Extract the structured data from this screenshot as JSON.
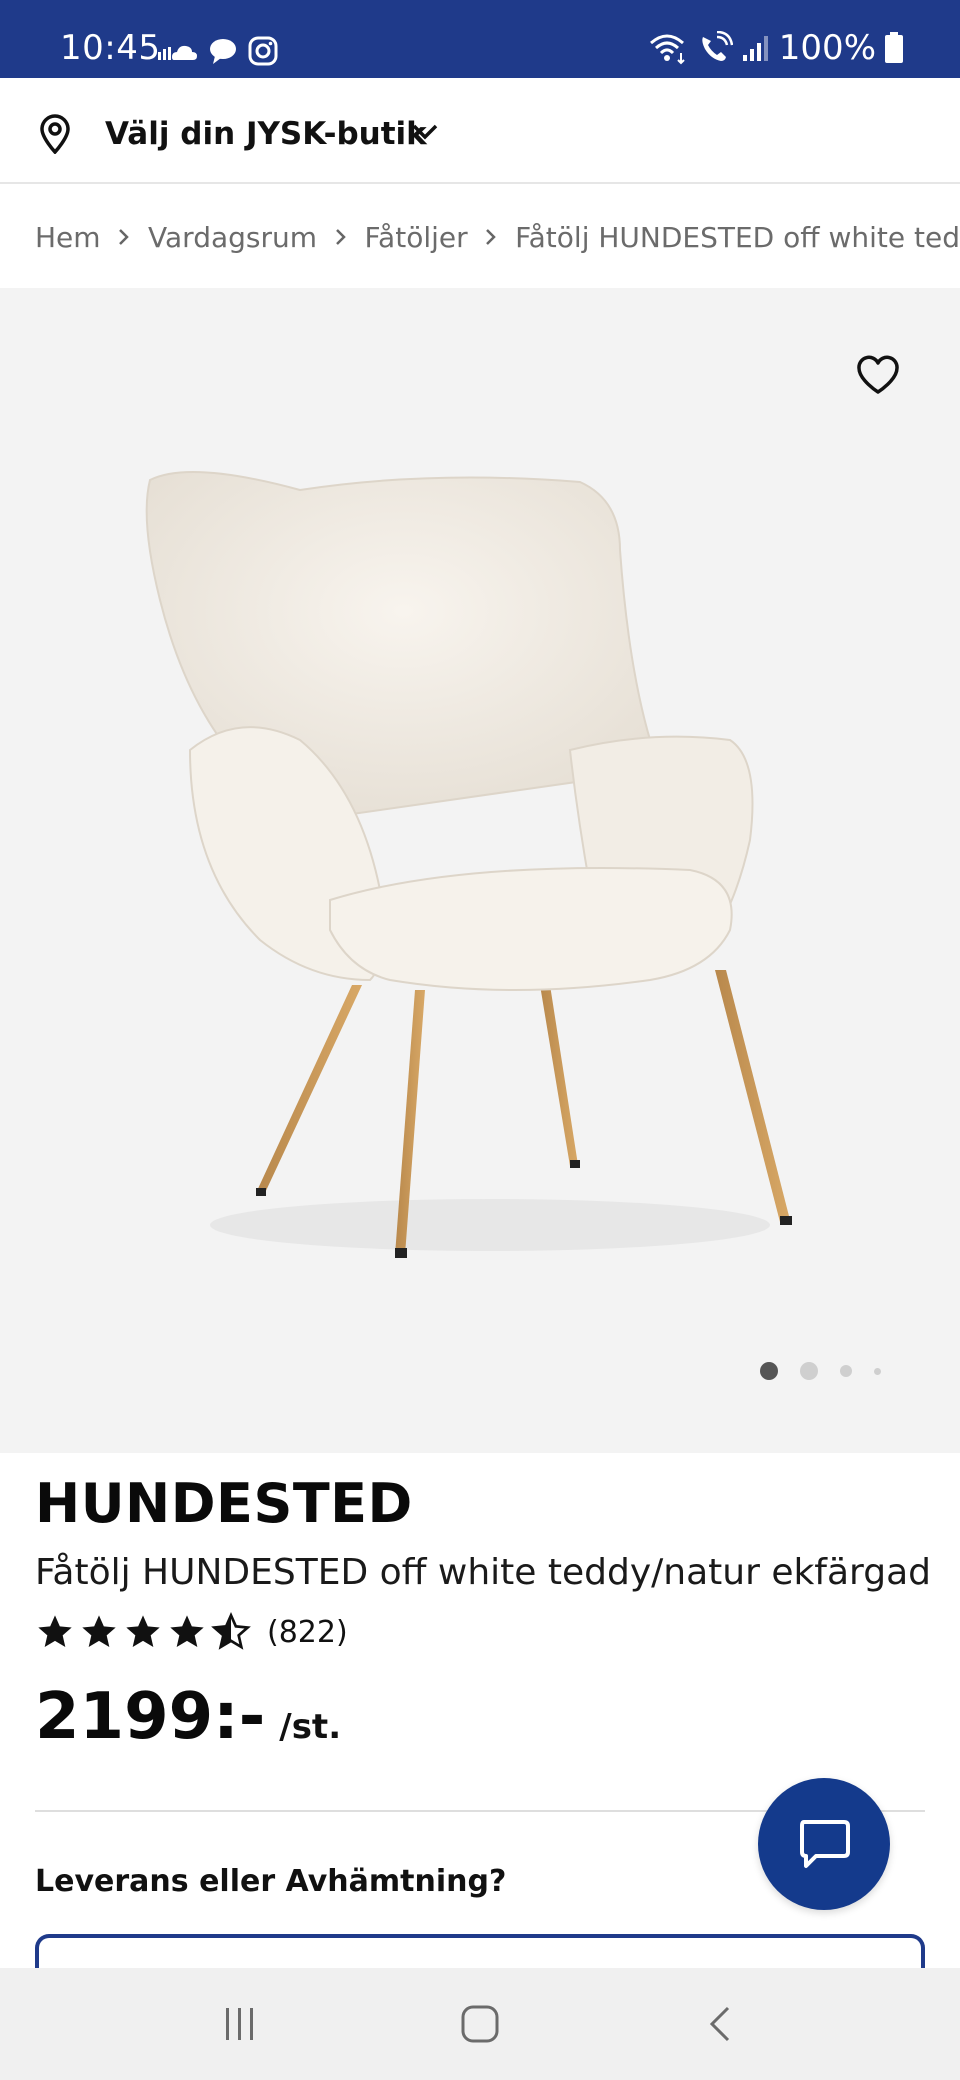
{
  "status_bar": {
    "time": "10:45",
    "battery": "100%",
    "left_icons": [
      "cloud-icon",
      "chat-bubble-icon",
      "instagram-icon"
    ],
    "right_icons": [
      "wifi-icon",
      "wifi-call-icon",
      "signal-icon",
      "battery-icon"
    ]
  },
  "store_selector": {
    "label": "Välj din JYSK-butik"
  },
  "breadcrumb": {
    "items": [
      "Hem",
      "Vardagsrum",
      "Fåtöljer",
      "Fåtölj HUNDESTED off white ted"
    ]
  },
  "gallery": {
    "active_index": 0,
    "total": 4
  },
  "product": {
    "name": "HUNDESTED",
    "description": "Fåtölj HUNDESTED off white teddy/natur ekfärgad",
    "rating": 4.5,
    "rating_max": 5,
    "review_count": "(822)",
    "price": "2199:-",
    "price_unit": "/st."
  },
  "delivery": {
    "question": "Leverans eller Avhämtning?"
  },
  "colors": {
    "brand_blue": "#1f3a8a",
    "chat_blue": "#143a8c"
  }
}
